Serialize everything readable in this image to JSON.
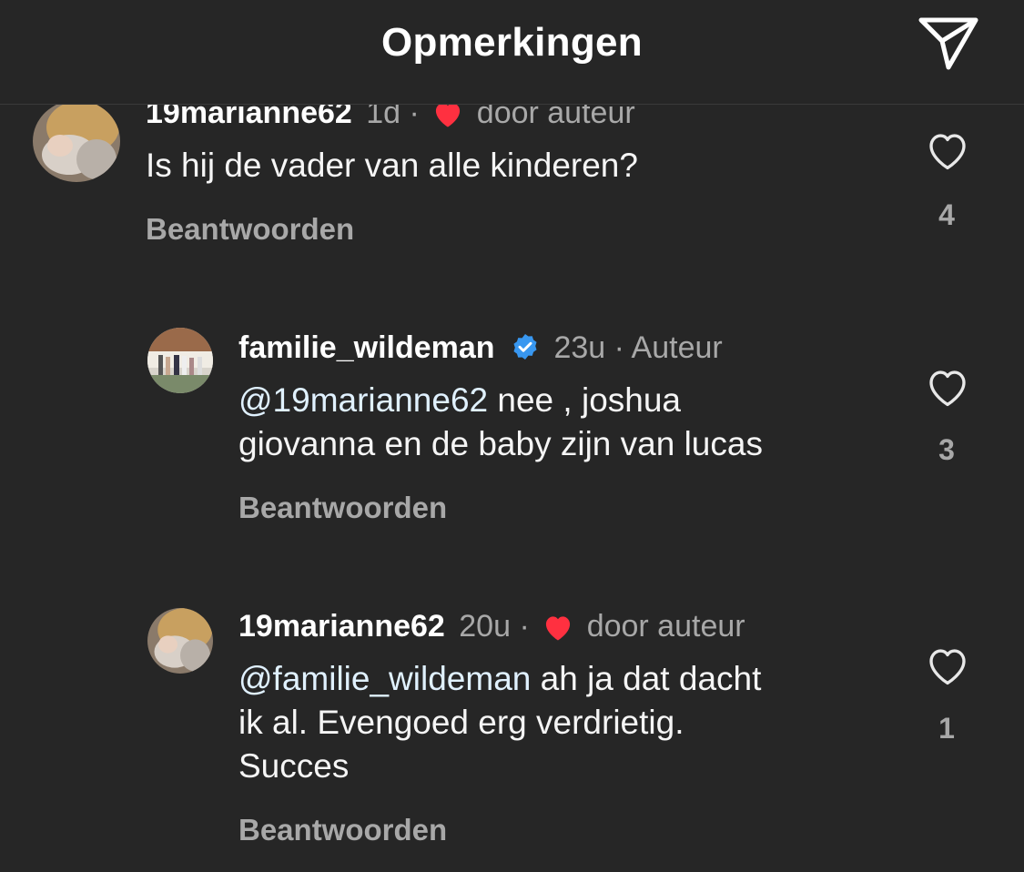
{
  "header": {
    "title": "Opmerkingen",
    "share_icon": "paper-plane-icon"
  },
  "comments": [
    {
      "username": "19marianne62",
      "time": "1d",
      "separator": "·",
      "liked_by_author_label": "door auteur",
      "text": "Is hij de vader van alle kinderen?",
      "reply_label": "Beantwoorden",
      "like_count": "4",
      "avatar_icon": "profile-photo-baby"
    },
    {
      "username": "familie_wildeman",
      "verified": true,
      "time": "23u",
      "separator": "·",
      "author_label": "Auteur",
      "mention": "@19marianne62",
      "text_line1": " nee , joshua",
      "text_line2": "giovanna en de baby zijn van lucas",
      "reply_label": "Beantwoorden",
      "like_count": "3",
      "avatar_icon": "profile-photo-family"
    },
    {
      "username": "19marianne62",
      "time": "20u",
      "separator": "·",
      "liked_by_author_label": "door auteur",
      "mention": "@familie_wildeman",
      "text_line1": " ah ja dat dacht",
      "text_line2": "ik al. Evengoed erg verdrietig.",
      "text_line3": "Succes",
      "reply_label": "Beantwoorden",
      "like_count": "1",
      "avatar_icon": "profile-photo-baby"
    }
  ],
  "colors": {
    "background": "#262626",
    "heart_red": "#ff3040",
    "verified_blue": "#3897f0",
    "secondary_text": "#a8a8a8",
    "mention": "#e0f1ff"
  }
}
